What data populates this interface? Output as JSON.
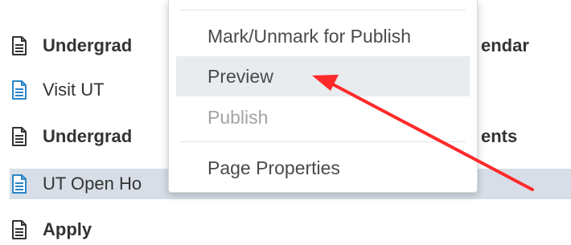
{
  "page_list": {
    "items": [
      {
        "label": "Undergrad",
        "hidden_suffix": "endar",
        "icon": "document-icon",
        "style": "bold",
        "icon_color": "#333333"
      },
      {
        "label": "Visit UT",
        "icon": "document-icon",
        "style": "normal",
        "icon_color": "#2a85c7"
      },
      {
        "label": "Undergrad",
        "hidden_suffix": "ents",
        "icon": "document-icon",
        "style": "bold",
        "icon_color": "#333333"
      },
      {
        "label": "UT Open Ho",
        "icon": "document-icon",
        "style": "selected",
        "icon_color": "#2a85c7"
      },
      {
        "label": "Apply",
        "icon": "document-icon",
        "style": "bold",
        "icon_color": "#333333"
      }
    ]
  },
  "context_menu": {
    "items": [
      {
        "label": "Mark/Unmark for Publish",
        "state": "normal"
      },
      {
        "label": "Preview",
        "state": "highlighted"
      },
      {
        "label": "Publish",
        "state": "disabled"
      },
      {
        "label": "Page Properties",
        "state": "normal"
      }
    ]
  },
  "annotation": {
    "type": "arrow",
    "color": "#ff2a2a",
    "points_to": "Preview"
  },
  "colors": {
    "selected_row_bg": "#d7dee7",
    "menu_highlight_bg": "#e9ecef",
    "text": "#333333",
    "disabled_text": "#a3a3a3"
  }
}
